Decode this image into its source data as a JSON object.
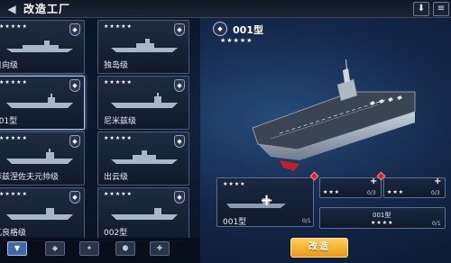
{
  "header": {
    "back_icon": "arrow-left-icon",
    "title": "改造工厂",
    "right_buttons": [
      {
        "icon": "download-icon",
        "glyph": "⬇"
      },
      {
        "icon": "menu-icon",
        "glyph": "≡"
      }
    ]
  },
  "ship_list": [
    {
      "name": "日向级",
      "stars": "★★★★★",
      "rank": "◆"
    },
    {
      "name": "独岛级",
      "stars": "★★★★★",
      "rank": "◆"
    },
    {
      "name": "001型",
      "stars": "★★★★★",
      "rank": "◆",
      "selected": true
    },
    {
      "name": "尼米兹级",
      "stars": "★★★★★",
      "rank": "◆"
    },
    {
      "name": "菲兹涅佐夫元帅级",
      "stars": "★★★★★",
      "rank": "◆"
    },
    {
      "name": "出云级",
      "stars": "★★★★★",
      "rank": "◆"
    },
    {
      "name": "瓦良格级",
      "stars": "★★★★★",
      "rank": "◆"
    },
    {
      "name": "002型",
      "stars": "★★★★★",
      "rank": "◆"
    }
  ],
  "filter_tabs": [
    {
      "glyph": "▼",
      "icon": "rank-1-icon",
      "active": true
    },
    {
      "glyph": "◆",
      "icon": "rank-2-icon"
    },
    {
      "glyph": "✦",
      "icon": "rank-3-icon"
    },
    {
      "glyph": "⬢",
      "icon": "rank-4-icon"
    },
    {
      "glyph": "✚",
      "icon": "rank-5-icon"
    }
  ],
  "selected_ship": {
    "badge": "◆",
    "name": "001型",
    "stars": "★★★★★"
  },
  "materials": {
    "main": {
      "stars": "★★★★",
      "name": "001型",
      "count": "0/1"
    },
    "slot_a": {
      "stars": "★★★",
      "count": "0/3"
    },
    "slot_b": {
      "stars": "★★★",
      "count": "0/3"
    },
    "slot_c": {
      "stars": "★★★★",
      "name": "001型",
      "count": "0/1"
    }
  },
  "actions": {
    "upgrade_label": "改造"
  },
  "colors": {
    "accent_gold": "#f0a424",
    "alert_red": "#d8202a",
    "panel_border": "#4a5a78"
  }
}
